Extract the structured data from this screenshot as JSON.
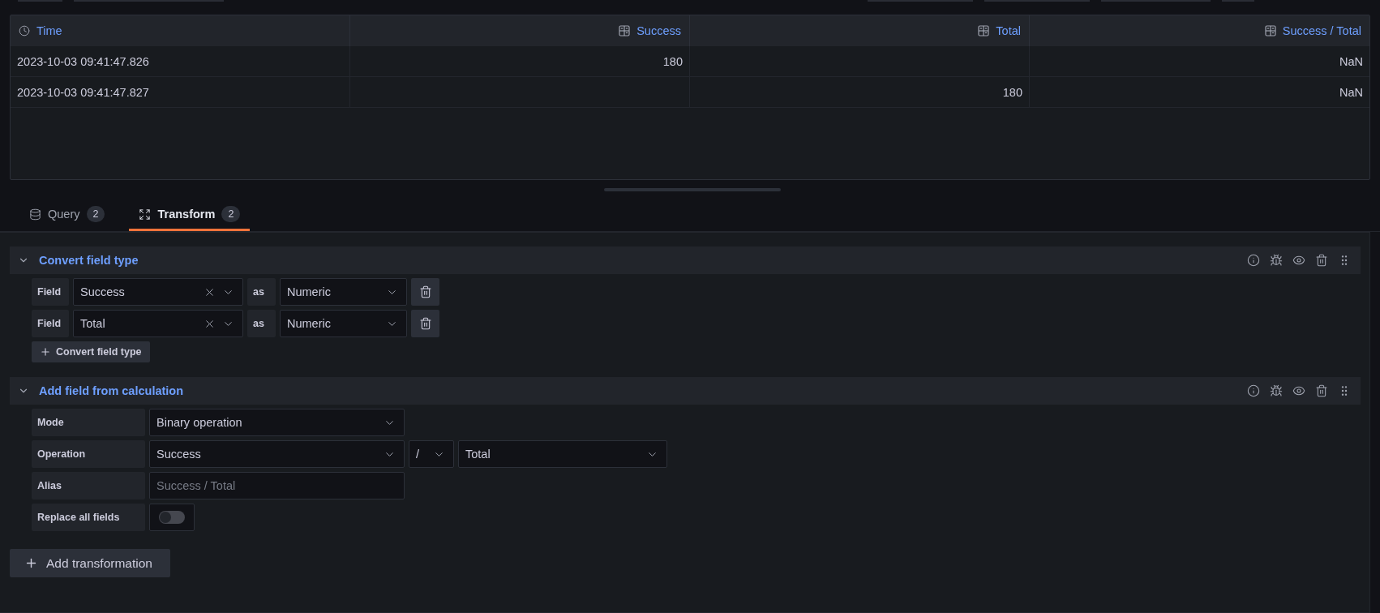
{
  "table": {
    "columns": [
      {
        "label": "Time",
        "kind": "time"
      },
      {
        "label": "Success",
        "kind": "number"
      },
      {
        "label": "Total",
        "kind": "number"
      },
      {
        "label": "Success / Total",
        "kind": "number"
      }
    ],
    "rows": [
      [
        "2023-10-03 09:41:47.826",
        "180",
        null,
        "NaN"
      ],
      [
        "2023-10-03 09:41:47.827",
        null,
        "180",
        "NaN"
      ]
    ]
  },
  "tabs": [
    {
      "kind": "query",
      "label": "Query",
      "count": "2",
      "selected": false
    },
    {
      "kind": "transform",
      "label": "Transform",
      "count": "2",
      "selected": true
    }
  ],
  "transformations": [
    {
      "kind": "convert",
      "title": "Convert field type",
      "expanded": true,
      "conversions": [
        {
          "label": "Field",
          "field": "Success",
          "connector": "as",
          "type": "Numeric"
        },
        {
          "label": "Field",
          "field": "Total",
          "connector": "as",
          "type": "Numeric"
        }
      ],
      "add_button": "Convert field type"
    },
    {
      "kind": "calculation",
      "title": "Add field from calculation",
      "expanded": true,
      "mode": {
        "label": "Mode",
        "value": "Binary operation"
      },
      "operation": {
        "label": "Operation",
        "left": "Success",
        "operator": "/",
        "right": "Total"
      },
      "alias": {
        "label": "Alias",
        "placeholder": "Success / Total"
      },
      "replace_all": {
        "label": "Replace all fields",
        "on": false
      }
    }
  ],
  "add_transformation": "Add transformation"
}
